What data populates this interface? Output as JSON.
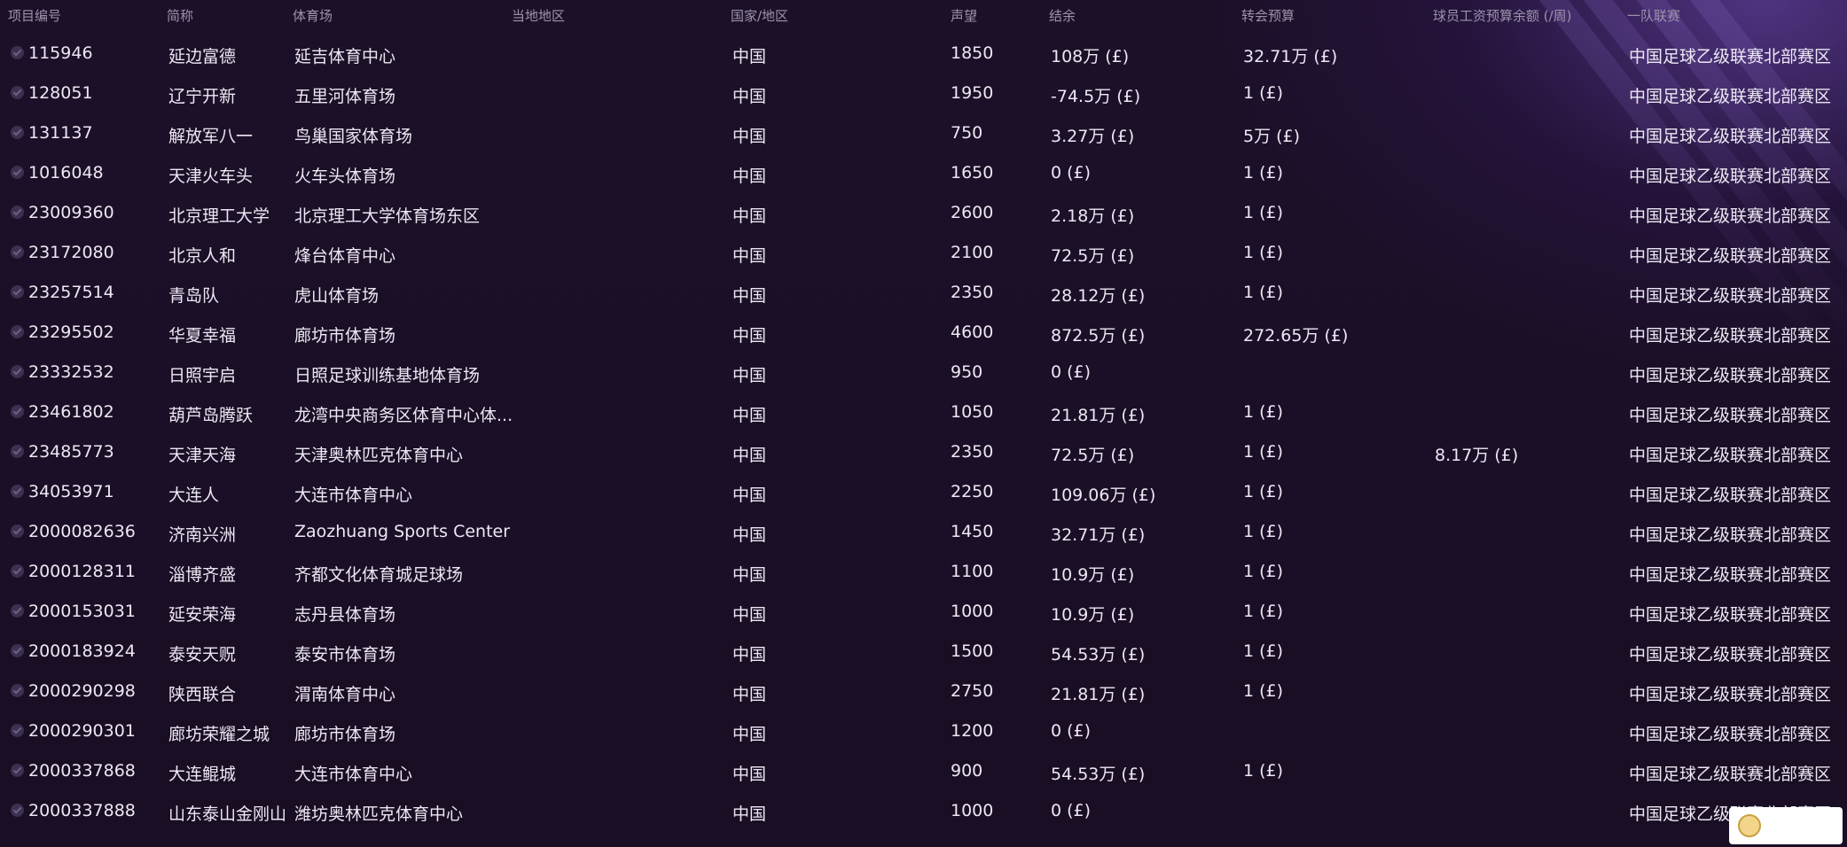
{
  "header": {
    "id": "项目编号",
    "short_name": "简称",
    "stadium": "体育场",
    "local_region": "当地地区",
    "nation": "国家/地区",
    "reputation": "声望",
    "balance": "结余",
    "transfer_budget": "转会预算",
    "wage_budget": "球员工资预算余额 (/周)",
    "league": "一队联赛"
  },
  "rows": [
    {
      "id": "115946",
      "short_name": "延边富德",
      "stadium": "延吉体育中心",
      "local_region": "",
      "nation": "中国",
      "reputation": "1850",
      "balance": "108万 (£)",
      "transfer_budget": "32.71万 (£)",
      "wage_budget": "",
      "league": "中国足球乙级联赛北部赛区"
    },
    {
      "id": "128051",
      "short_name": "辽宁开新",
      "stadium": "五里河体育场",
      "local_region": "",
      "nation": "中国",
      "reputation": "1950",
      "balance": "-74.5万 (£)",
      "transfer_budget": "1 (£)",
      "wage_budget": "",
      "league": "中国足球乙级联赛北部赛区"
    },
    {
      "id": "131137",
      "short_name": "解放军八一",
      "stadium": "鸟巢国家体育场",
      "local_region": "",
      "nation": "中国",
      "reputation": "750",
      "balance": "3.27万 (£)",
      "transfer_budget": "5万 (£)",
      "wage_budget": "",
      "league": "中国足球乙级联赛北部赛区"
    },
    {
      "id": "1016048",
      "short_name": "天津火车头",
      "stadium": "火车头体育场",
      "local_region": "",
      "nation": "中国",
      "reputation": "1650",
      "balance": "0 (£)",
      "transfer_budget": "1 (£)",
      "wage_budget": "",
      "league": "中国足球乙级联赛北部赛区"
    },
    {
      "id": "23009360",
      "short_name": "北京理工大学",
      "stadium": "北京理工大学体育场东区",
      "local_region": "",
      "nation": "中国",
      "reputation": "2600",
      "balance": "2.18万 (£)",
      "transfer_budget": "1 (£)",
      "wage_budget": "",
      "league": "中国足球乙级联赛北部赛区"
    },
    {
      "id": "23172080",
      "short_name": "北京人和",
      "stadium": "烽台体育中心",
      "local_region": "",
      "nation": "中国",
      "reputation": "2100",
      "balance": "72.5万 (£)",
      "transfer_budget": "1 (£)",
      "wage_budget": "",
      "league": "中国足球乙级联赛北部赛区"
    },
    {
      "id": "23257514",
      "short_name": "青岛队",
      "stadium": "虎山体育场",
      "local_region": "",
      "nation": "中国",
      "reputation": "2350",
      "balance": "28.12万 (£)",
      "transfer_budget": "1 (£)",
      "wage_budget": "",
      "league": "中国足球乙级联赛北部赛区"
    },
    {
      "id": "23295502",
      "short_name": "华夏幸福",
      "stadium": "廊坊市体育场",
      "local_region": "",
      "nation": "中国",
      "reputation": "4600",
      "balance": "872.5万 (£)",
      "transfer_budget": "272.65万 (£)",
      "wage_budget": "",
      "league": "中国足球乙级联赛北部赛区"
    },
    {
      "id": "23332532",
      "short_name": "日照宇启",
      "stadium": "日照足球训练基地体育场",
      "local_region": "",
      "nation": "中国",
      "reputation": "950",
      "balance": "0 (£)",
      "transfer_budget": "",
      "wage_budget": "",
      "league": "中国足球乙级联赛北部赛区"
    },
    {
      "id": "23461802",
      "short_name": "葫芦岛腾跃",
      "stadium": "龙湾中央商务区体育中心体...",
      "local_region": "",
      "nation": "中国",
      "reputation": "1050",
      "balance": "21.81万 (£)",
      "transfer_budget": "1 (£)",
      "wage_budget": "",
      "league": "中国足球乙级联赛北部赛区"
    },
    {
      "id": "23485773",
      "short_name": "天津天海",
      "stadium": "天津奥林匹克体育中心",
      "local_region": "",
      "nation": "中国",
      "reputation": "2350",
      "balance": "72.5万 (£)",
      "transfer_budget": "1 (£)",
      "wage_budget": "8.17万 (£)",
      "league": "中国足球乙级联赛北部赛区"
    },
    {
      "id": "34053971",
      "short_name": "大连人",
      "stadium": "大连市体育中心",
      "local_region": "",
      "nation": "中国",
      "reputation": "2250",
      "balance": "109.06万 (£)",
      "transfer_budget": "1 (£)",
      "wage_budget": "",
      "league": "中国足球乙级联赛北部赛区"
    },
    {
      "id": "2000082636",
      "short_name": "济南兴洲",
      "stadium": "Zaozhuang Sports Center",
      "local_region": "",
      "nation": "中国",
      "reputation": "1450",
      "balance": "32.71万 (£)",
      "transfer_budget": "1 (£)",
      "wage_budget": "",
      "league": "中国足球乙级联赛北部赛区"
    },
    {
      "id": "2000128311",
      "short_name": "淄博齐盛",
      "stadium": "齐都文化体育城足球场",
      "local_region": "",
      "nation": "中国",
      "reputation": "1100",
      "balance": "10.9万 (£)",
      "transfer_budget": "1 (£)",
      "wage_budget": "",
      "league": "中国足球乙级联赛北部赛区"
    },
    {
      "id": "2000153031",
      "short_name": "延安荣海",
      "stadium": "志丹县体育场",
      "local_region": "",
      "nation": "中国",
      "reputation": "1000",
      "balance": "10.9万 (£)",
      "transfer_budget": "1 (£)",
      "wage_budget": "",
      "league": "中国足球乙级联赛北部赛区"
    },
    {
      "id": "2000183924",
      "short_name": "泰安天贶",
      "stadium": "泰安市体育场",
      "local_region": "",
      "nation": "中国",
      "reputation": "1500",
      "balance": "54.53万 (£)",
      "transfer_budget": "1 (£)",
      "wage_budget": "",
      "league": "中国足球乙级联赛北部赛区"
    },
    {
      "id": "2000290298",
      "short_name": "陕西联合",
      "stadium": "渭南体育中心",
      "local_region": "",
      "nation": "中国",
      "reputation": "2750",
      "balance": "21.81万 (£)",
      "transfer_budget": "1 (£)",
      "wage_budget": "",
      "league": "中国足球乙级联赛北部赛区"
    },
    {
      "id": "2000290301",
      "short_name": "廊坊荣耀之城",
      "stadium": "廊坊市体育场",
      "local_region": "",
      "nation": "中国",
      "reputation": "1200",
      "balance": "0 (£)",
      "transfer_budget": "",
      "wage_budget": "",
      "league": "中国足球乙级联赛北部赛区"
    },
    {
      "id": "2000337868",
      "short_name": "大连鲲城",
      "stadium": "大连市体育中心",
      "local_region": "",
      "nation": "中国",
      "reputation": "900",
      "balance": "54.53万 (£)",
      "transfer_budget": "1 (£)",
      "wage_budget": "",
      "league": "中国足球乙级联赛北部赛区"
    },
    {
      "id": "2000337888",
      "short_name": "山东泰山金刚山",
      "stadium": "潍坊奥林匹克体育中心",
      "local_region": "",
      "nation": "中国",
      "reputation": "1000",
      "balance": "0 (£)",
      "transfer_budget": "",
      "wage_budget": "",
      "league": "中国足球乙级联赛北部赛区"
    }
  ],
  "icons": {
    "row_check": "check-circle-icon",
    "corner_widget": "mascot-icon"
  },
  "colors": {
    "background": "#1a0f26",
    "glow": "#7850c8",
    "header_text": "#9c93ab",
    "row_text": "#ece8f3"
  }
}
